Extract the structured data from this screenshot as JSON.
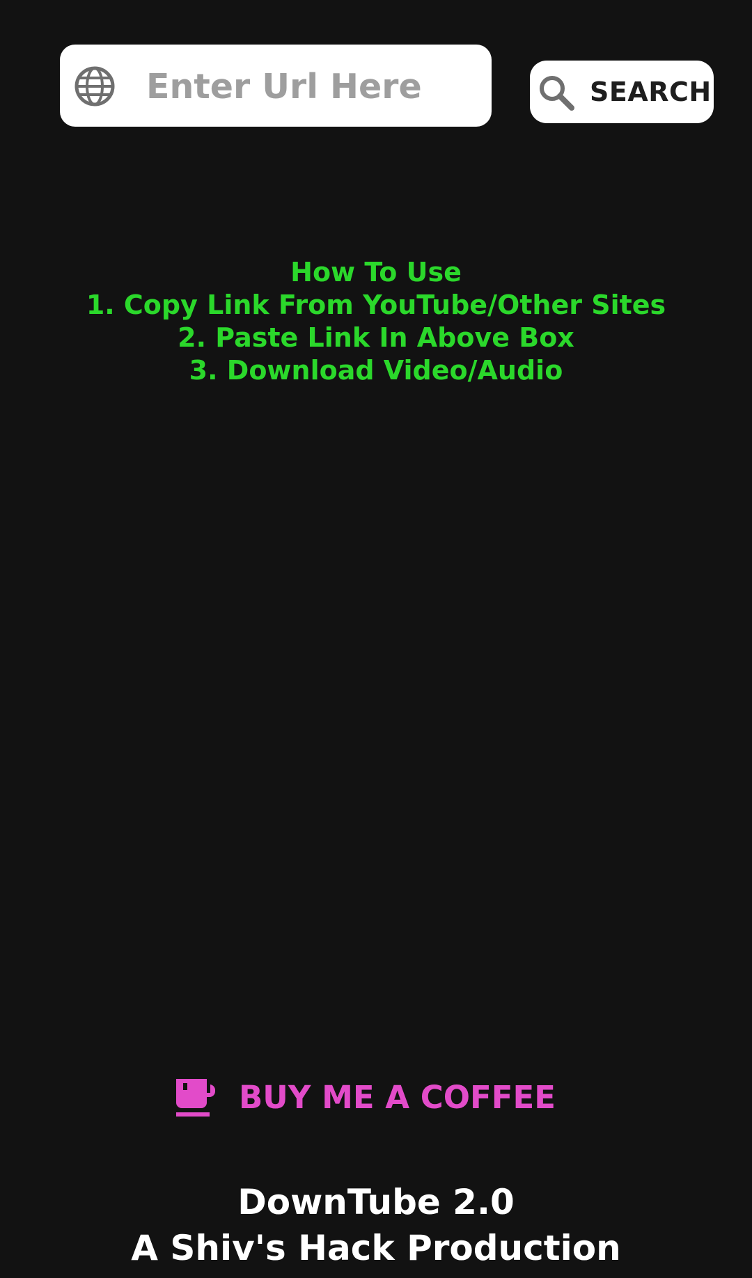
{
  "search": {
    "placeholder": "Enter Url Here",
    "value": "",
    "button_label": "SEARCH"
  },
  "instructions": {
    "title": "How To Use",
    "steps": [
      "1. Copy Link From YouTube/Other Sites",
      "2. Paste Link In Above Box",
      "3. Download Video/Audio"
    ]
  },
  "coffee": {
    "label": "BUY ME A COFFEE"
  },
  "footer": {
    "app_name": "DownTube 2.0",
    "credit": "A Shiv's Hack Production"
  },
  "colors": {
    "background": "#121212",
    "instructions_text": "#2bd82b",
    "coffee_accent": "#e24bc9",
    "footer_text": "#ffffff",
    "icon_gray": "#6f6f6f"
  },
  "icons": {
    "url_field": "globe-icon",
    "search_button": "search-icon",
    "coffee_button": "coffee-cup-icon"
  }
}
